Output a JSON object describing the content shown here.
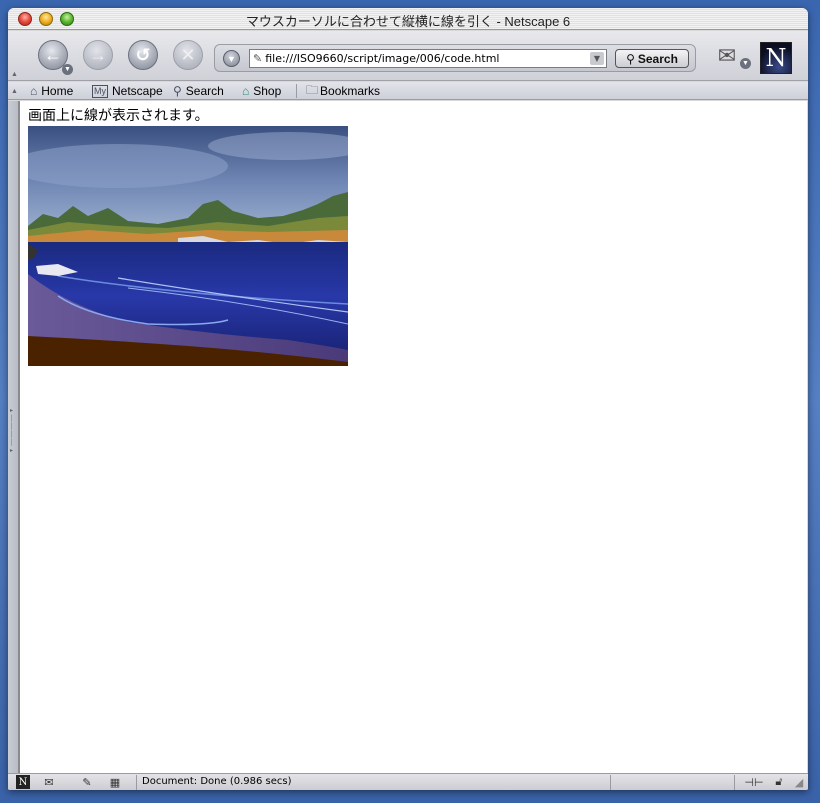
{
  "window": {
    "title": "マウスカーソルに合わせて縦横に線を引く - Netscape 6"
  },
  "navbar": {
    "url": "file:///ISO9660/script/image/006/code.html",
    "search_label": "Search",
    "logo_letter": "N"
  },
  "personal_toolbar": {
    "items": [
      {
        "label": "Home",
        "icon": "home-icon"
      },
      {
        "label": "Netscape",
        "icon": "my-netscape-icon",
        "badge": "My"
      },
      {
        "label": "Search",
        "icon": "search-icon"
      },
      {
        "label": "Shop",
        "icon": "shop-icon"
      },
      {
        "label": "Bookmarks",
        "icon": "folder-icon"
      }
    ]
  },
  "content": {
    "text": "画面上に線が表示されます。",
    "image_description_visible": false
  },
  "statusbar": {
    "text": "Document: Done (0.986 secs)"
  }
}
